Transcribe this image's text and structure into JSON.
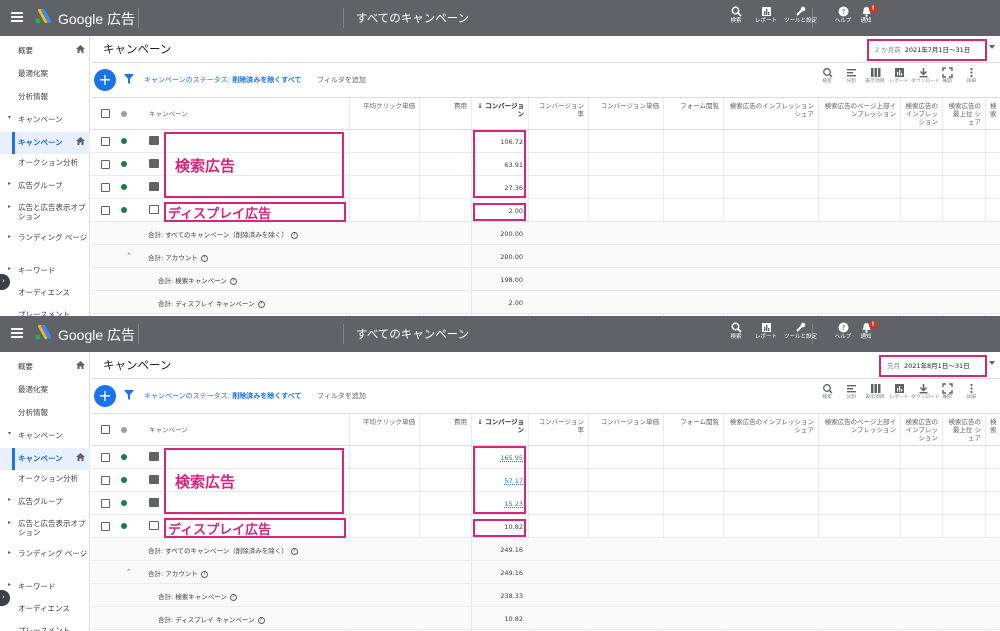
{
  "app": {
    "brand": "Google 広告",
    "page_header": "すべてのキャンペーン"
  },
  "topbar_buttons": [
    {
      "name": "search",
      "label": "検索"
    },
    {
      "name": "reports",
      "label": "レポート"
    },
    {
      "name": "tools",
      "label": "ツールと設定"
    },
    {
      "name": "help",
      "label": "ヘルプ"
    },
    {
      "name": "notifications",
      "label": "通知",
      "badge": "!"
    }
  ],
  "sidebar": {
    "items": [
      {
        "label": "概要",
        "home": true
      },
      {
        "label": "最適化案"
      },
      {
        "label": "分析情報"
      },
      {
        "label": "キャンペーン",
        "arrow": "▾"
      },
      {
        "label": "キャンペーン",
        "active": true,
        "home": true
      },
      {
        "label": "オークション分析"
      },
      {
        "label": "広告グループ",
        "arrow": "▸"
      },
      {
        "label": "広告と広告表示オプション",
        "arrow": "▸",
        "multi": true
      },
      {
        "label": "ランディング ページ",
        "arrow": "▸",
        "multi": true
      },
      {
        "label": "キーワード",
        "arrow": "▸"
      },
      {
        "label": "オーディエンス"
      },
      {
        "label": "プレースメント"
      }
    ]
  },
  "page_title": "キャンペーン",
  "filter": {
    "status_prefix": "キャンペーンのステータス: ",
    "status_value": "削除済みを除くすべて",
    "add_filter": "フィルタを追加"
  },
  "toolbar": [
    {
      "name": "search",
      "label": "検索"
    },
    {
      "name": "segment",
      "label": "分割"
    },
    {
      "name": "columns",
      "label": "表示項目"
    },
    {
      "name": "reports",
      "label": "レポート"
    },
    {
      "name": "download",
      "label": "ダウンロード"
    },
    {
      "name": "expand",
      "label": "展開"
    },
    {
      "name": "more",
      "label": "詳細"
    }
  ],
  "table": {
    "headers": {
      "campaign": "キャンペーン",
      "avg_cpc": "平均クリック単価",
      "cost": "費用",
      "conversions": "↓ コンバージョン",
      "conv_rate": "コンバージョン率",
      "cost_per_conv": "コンバージョン単価",
      "form_views": "フォーム閲覧",
      "search_impr_share": "検索広告のインプレッション シェア",
      "search_top_impr": "検索広告のページ上部インプレッション",
      "search_lost": "検索広告のインプレッション",
      "search_abs_top": "検索広告の最上位 シェア",
      "more": "検索"
    },
    "total_labels": {
      "all": "合計: すべてのキャンペーン（削除済みを除く）",
      "account": "合計: アカウント",
      "search": "合計: 検索キャンペーン",
      "display": "合計: ディスプレイ キャンペーン"
    }
  },
  "annotations": {
    "search_ads": "検索広告",
    "display_ads": "ディスプレイ広告"
  },
  "panels": [
    {
      "date_prefix": "2 か月前",
      "date_value": "2021年7月1日～31日",
      "rows": [
        {
          "type": "search",
          "conversions": "106.72"
        },
        {
          "type": "search",
          "conversions": "63.91"
        },
        {
          "type": "search",
          "conversions": "27.36"
        },
        {
          "type": "display",
          "conversions": "2.00"
        }
      ],
      "totals": {
        "all": "200.00",
        "account": "200.00",
        "search": "198.00",
        "display": "2.00"
      }
    },
    {
      "date_prefix": "先月",
      "date_value": "2021年8月1日～31日",
      "rows": [
        {
          "type": "search",
          "conversions": "165.95",
          "link": true
        },
        {
          "type": "search",
          "conversions": "57.17",
          "link": true
        },
        {
          "type": "search",
          "conversions": "15.23",
          "link": true
        },
        {
          "type": "display",
          "conversions": "10.82"
        }
      ],
      "totals": {
        "all": "249.16",
        "account": "249.16",
        "search": "238.33",
        "display": "10.82"
      }
    }
  ],
  "colors": {
    "topbar": "#5f6368",
    "accent": "#1a73e8",
    "highlight": "#d6257c",
    "status_green": "#188038"
  }
}
